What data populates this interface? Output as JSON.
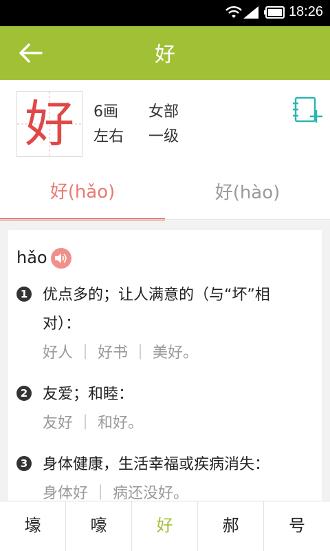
{
  "status_bar": {
    "time": "18:26"
  },
  "app_bar": {
    "title": "好"
  },
  "character": {
    "glyph": "好",
    "strokes": "6画",
    "radical": "女部",
    "structure": "左右",
    "level": "一级"
  },
  "tabs": [
    {
      "label": "好(hǎo)",
      "active": true
    },
    {
      "label": "好(hào)",
      "active": false
    }
  ],
  "definitions": {
    "pinyin": "hǎo",
    "items": [
      {
        "number": "1",
        "text_line1": "优点多的；让人满意的（与“坏”相",
        "text_line2": "对）：",
        "examples": "好人 ｜ 好书 ｜ 美好。"
      },
      {
        "number": "2",
        "text_line1": "友爱；和睦：",
        "examples": "友好 ｜ 和好。"
      },
      {
        "number": "3",
        "text_line1": "身体健康，生活幸福或疾病消失：",
        "examples": "身体好 ｜ 病还没好。"
      }
    ]
  },
  "bottom_chars": [
    "壕",
    "嚎",
    "好",
    "郝",
    "号"
  ],
  "colors": {
    "accent_green": "#a0c035",
    "accent_red": "#e87a72",
    "teal_icon": "#2bb5b0"
  }
}
